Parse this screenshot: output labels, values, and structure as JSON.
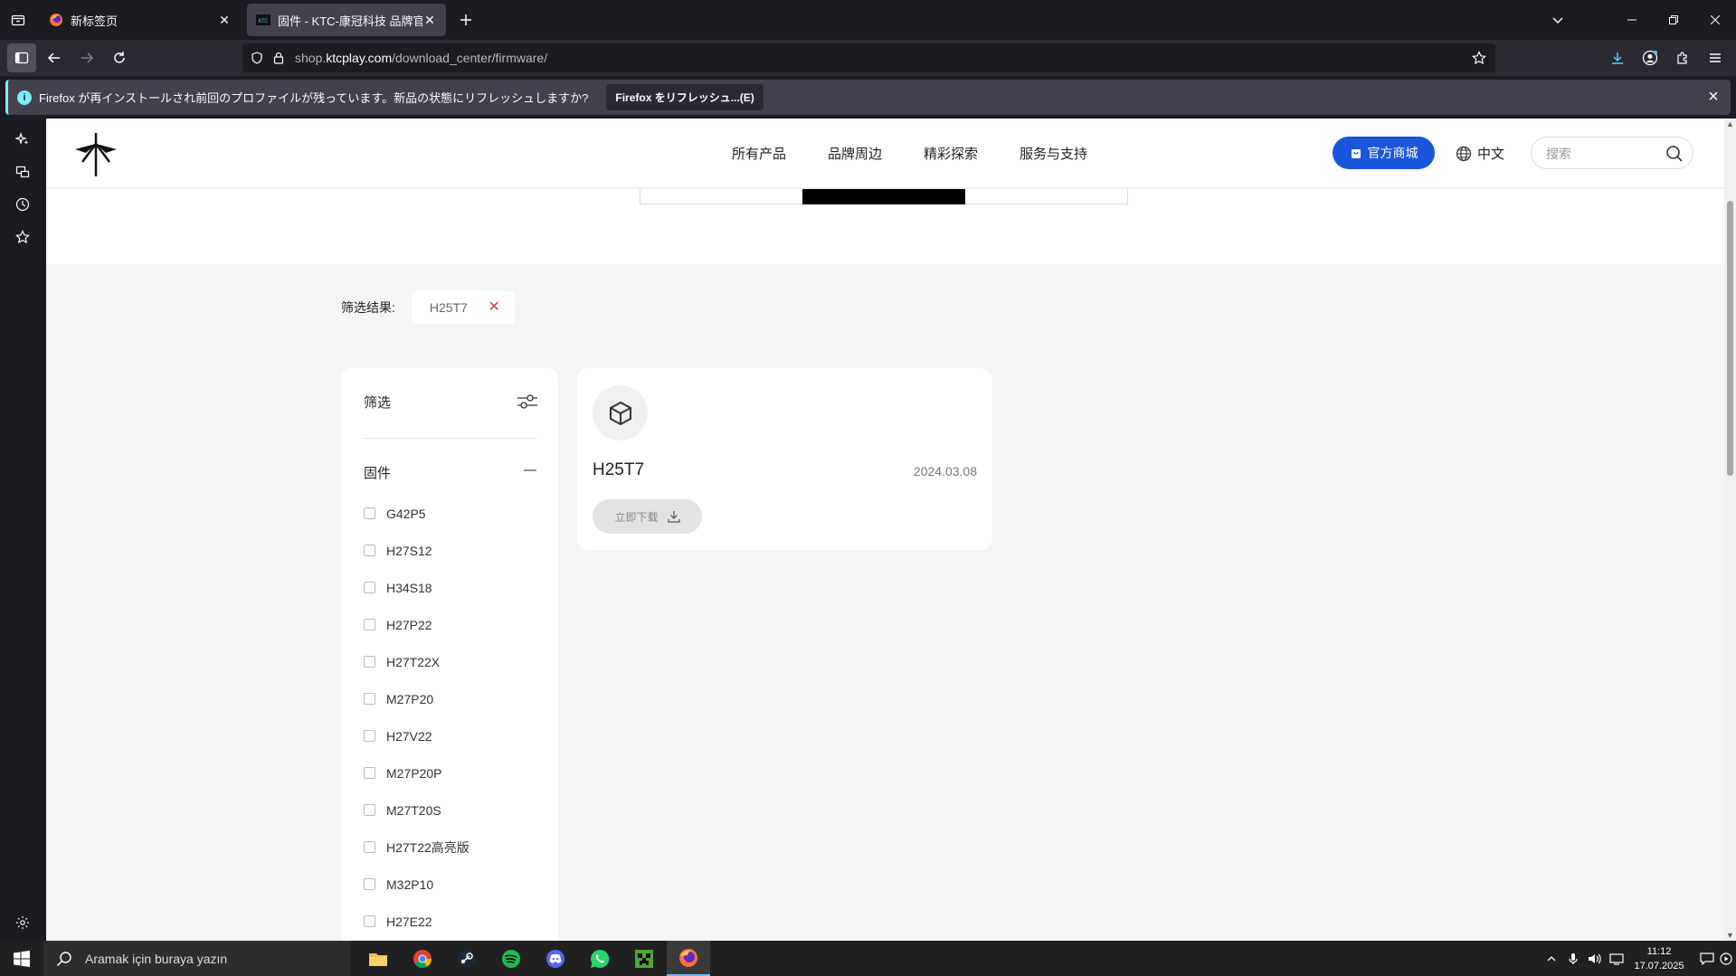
{
  "browser": {
    "tabs": [
      {
        "title": "新标签页",
        "active": false
      },
      {
        "title": "固件 - KTC-康冠科技 品牌官方商城",
        "active": true
      }
    ],
    "url": {
      "prefix": "shop.",
      "host": "ktcplay.com",
      "path": "/download_center/firmware/"
    },
    "notification": {
      "message": "Firefox が再インストールされ前回のプロファイルが残っています。新品の状態にリフレッシュしますか?",
      "button": "Firefox をリフレッシュ...(E)"
    }
  },
  "site": {
    "menu": [
      "所有产品",
      "品牌周边",
      "精彩探索",
      "服务与支持"
    ],
    "shop_button": "官方商城",
    "language": "中文",
    "search_placeholder": "搜索",
    "filter_result_label": "筛选结果:",
    "filter_chip": "H25T7",
    "filter_panel": {
      "title": "筛选",
      "category": "固件",
      "items": [
        "G42P5",
        "H27S12",
        "H34S18",
        "H27P22",
        "H27T22X",
        "M27P20",
        "H27V22",
        "M27P20P",
        "M27T20S",
        "H27T22高亮版",
        "M32P10",
        "H27E22"
      ]
    },
    "product": {
      "name": "H25T7",
      "date": "2024.03.08",
      "download_label": "立即下载"
    }
  },
  "taskbar": {
    "search_placeholder": "Aramak için buraya yazın",
    "apps": [
      "file-explorer",
      "chrome",
      "steam",
      "spotify",
      "discord",
      "whatsapp",
      "minecraft",
      "firefox"
    ],
    "time": "11:12",
    "date": "17.07.2025"
  },
  "colors": {
    "accent": "#1a56db",
    "chip_remove": "#e53935",
    "browser_bg": "#1c1b22",
    "info": "#80ebff"
  }
}
